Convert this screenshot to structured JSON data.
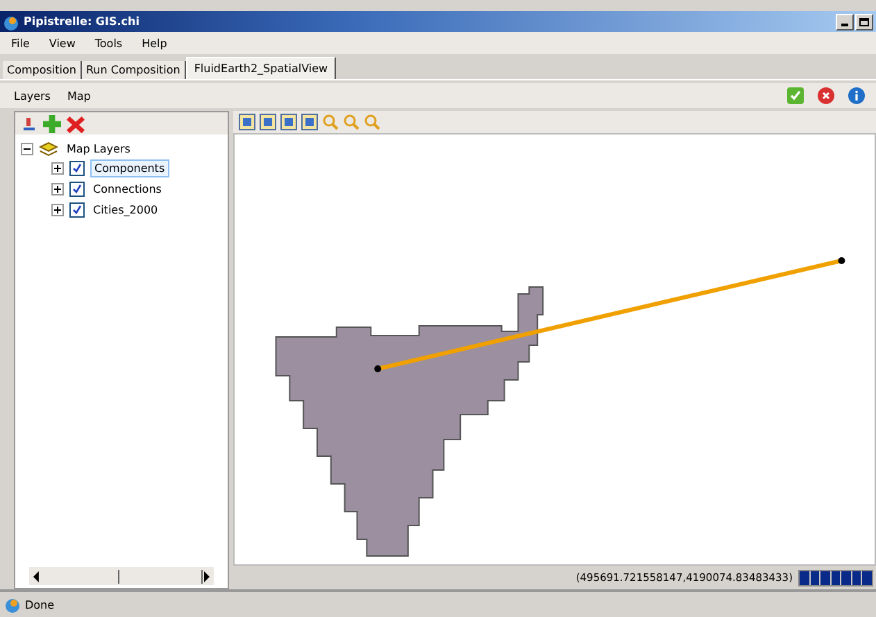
{
  "window": {
    "title": "Pipistrelle: GIS.chi"
  },
  "menu": [
    "File",
    "View",
    "Tools",
    "Help"
  ],
  "tabs": [
    {
      "label": "Composition",
      "selected": false
    },
    {
      "label": "Run Composition",
      "selected": false
    },
    {
      "label": "FluidEarth2_SpatialView",
      "selected": true
    }
  ],
  "view_menu": [
    "Layers",
    "Map"
  ],
  "layers": {
    "root": {
      "label": "Map Layers",
      "expanded": true,
      "children": [
        {
          "label": "Components",
          "checked": true,
          "selected": true,
          "expanded": false
        },
        {
          "label": "Connections",
          "checked": true,
          "selected": false,
          "expanded": false
        },
        {
          "label": "Cities_2000",
          "checked": true,
          "selected": false,
          "expanded": false
        }
      ]
    }
  },
  "coordinates": "(495691.721558147,4190074.83483433)",
  "progress": {
    "level": 1
  },
  "status_bar": "Done"
}
